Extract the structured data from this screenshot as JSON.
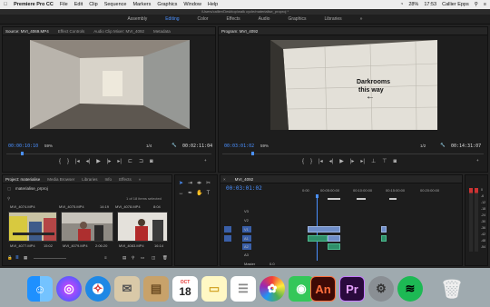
{
  "menubar": {
    "app_name": "Premiere Pro CC",
    "items": [
      "File",
      "Edit",
      "Clip",
      "Sequence",
      "Markers",
      "Graphics",
      "Window",
      "Help"
    ],
    "battery": "28%",
    "time": "17:53",
    "user": "Callier Epps"
  },
  "path": "/Users/callier/Desktop/walk cycle/materialise_proproj *",
  "workspaces": [
    "Assembly",
    "Editing",
    "Color",
    "Effects",
    "Audio",
    "Graphics",
    "Libraries"
  ],
  "workspace_active": "Editing",
  "workspace_more": "»",
  "source": {
    "tabs": [
      "Source: MVI_4069.MP4",
      "Effect Controls",
      "Audio Clip Mixer: MVI_4092",
      "Metadata"
    ],
    "timecode": "00:00:10:10",
    "zoom": "59%",
    "resolution": "1/4",
    "duration": "00:02:11:04"
  },
  "program": {
    "tabs": [
      "Program: MVI_4092"
    ],
    "timecode": "00:03:01:02",
    "zoom": "59%",
    "resolution": "1/2",
    "duration": "00:14:31:07",
    "sign_line1": "Darkrooms",
    "sign_line2": "this way",
    "sign_arrow": "←"
  },
  "project": {
    "tabs": [
      "Project: materialise",
      "Media Browser",
      "Libraries",
      "Info",
      "Effects",
      "»"
    ],
    "file_name": "materialise_prproj",
    "selection": "1 of 18 items selected",
    "top_captions": [
      "MVI_4074.MP4",
      "MVI_4075.MP4",
      "MVI_4078.MP4"
    ],
    "top_durations": [
      "14:19",
      "8:04"
    ],
    "items": [
      {
        "name": "MVI_4077.MP4",
        "duration": "15:02"
      },
      {
        "name": "MVI_4079.MP4",
        "duration": "2:06:20"
      },
      {
        "name": "MVI_4083.MP4",
        "duration": "16:14"
      }
    ]
  },
  "timeline": {
    "sequence_tab": "MVI_4092",
    "timecode": "00:03:01:02",
    "ruler": [
      "0:00",
      "00:05:00:00",
      "00:10:00:00",
      "00:15:00:00",
      "00:20:00:00"
    ],
    "video_tracks": [
      "V3",
      "V2",
      "V1"
    ],
    "audio_tracks": [
      "A1",
      "A2",
      "A3"
    ],
    "master_label": "Master",
    "master_value": "0.0"
  },
  "meter_labels": [
    "0",
    "-6",
    "-12",
    "-18",
    "-24",
    "-30",
    "-36",
    "-42",
    "-48",
    "-54"
  ],
  "colors": {
    "accent": "#4a90ff",
    "panel": "#1d1d1d",
    "video_clip": "#6f8ec9",
    "audio_clip": "#2f8f6a"
  },
  "dock": {
    "calendar_month": "OCT",
    "calendar_day": "18",
    "animate_label": "An",
    "premiere_label": "Pr"
  }
}
